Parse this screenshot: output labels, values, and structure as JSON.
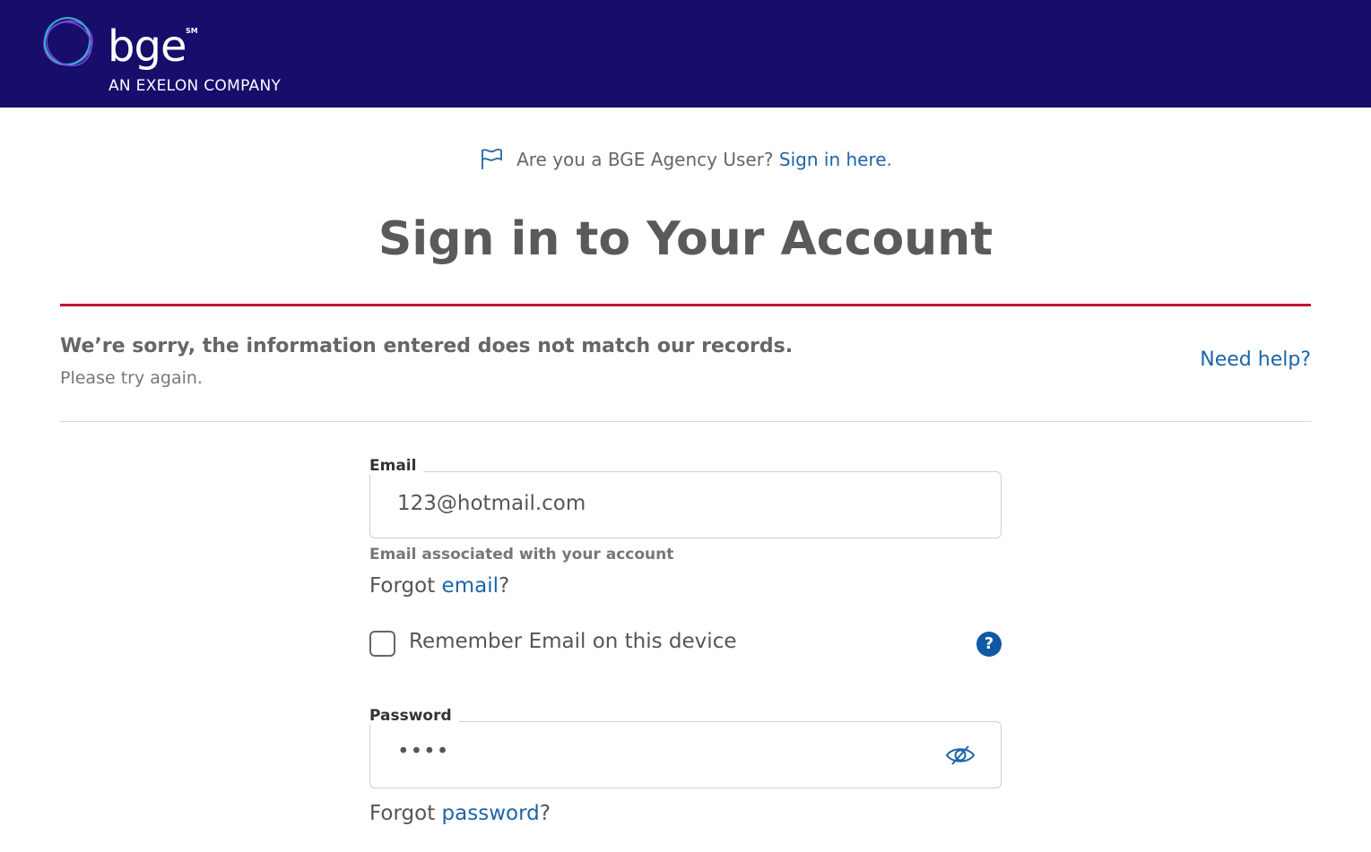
{
  "header": {
    "brand": "bge",
    "brand_mark": "SM",
    "tagline": "AN EXELON COMPANY",
    "bg_color": "#170d6b"
  },
  "agency": {
    "icon": "flag-icon",
    "prompt": "Are you a BGE Agency User?",
    "link": "Sign in here",
    "suffix": "."
  },
  "page_title": "Sign in to Your Account",
  "error": {
    "title": "We’re sorry, the information entered does not match our records.",
    "subtitle": "Please try again.",
    "accent_color": "#c1123a"
  },
  "need_help": "Need help?",
  "email": {
    "label": "Email",
    "value": "123@hotmail.com",
    "hint": "Email associated with your account",
    "forgot_prefix": "Forgot ",
    "forgot_link": "email",
    "forgot_suffix": "?"
  },
  "remember": {
    "label": "Remember Email on this device",
    "checked": false,
    "help_icon": "question-circle-icon",
    "help_glyph": "?"
  },
  "password": {
    "label": "Password",
    "value": "••••",
    "toggle_icon": "eye-slash-icon",
    "forgot_prefix": "Forgot ",
    "forgot_link": "password",
    "forgot_suffix": "?"
  },
  "link_color": "#1d64a8"
}
